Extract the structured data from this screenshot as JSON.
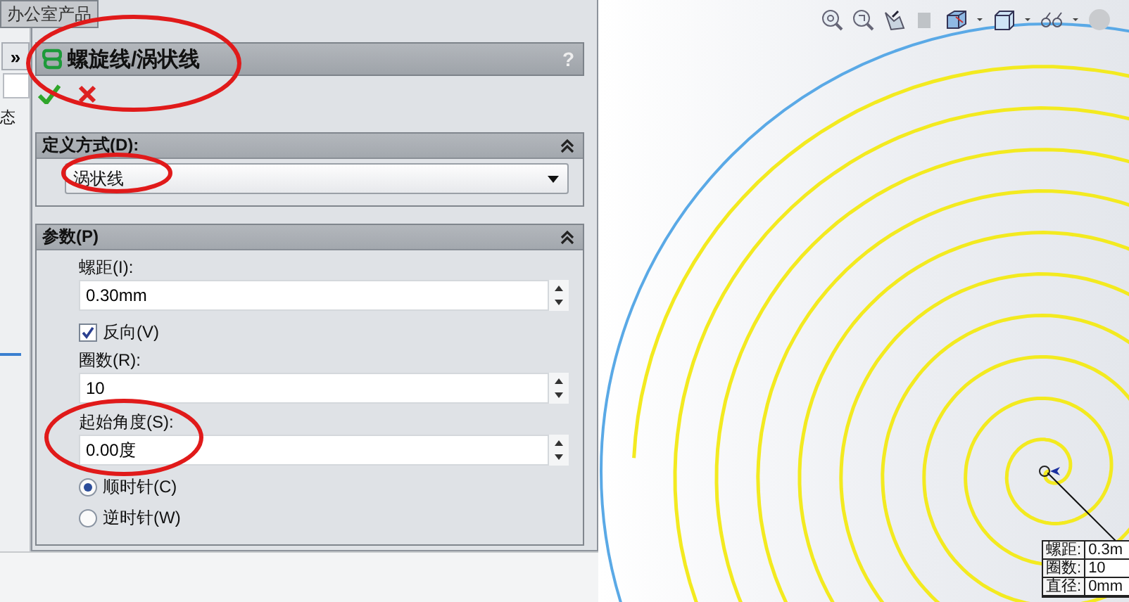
{
  "tab": {
    "label": "办公室产品"
  },
  "side_strip": {
    "expand": "»",
    "label": "态"
  },
  "property_manager": {
    "title": "螺旋线/涡状线",
    "help": "?",
    "definition": {
      "title": "定义方式(D):",
      "expanded": true,
      "value": "涡状线"
    },
    "parameters": {
      "title": "参数(P)",
      "expanded": true,
      "items": [
        {
          "kind": "spin",
          "label": "螺距(I):",
          "value": "0.30mm"
        },
        {
          "kind": "checkbox",
          "label": "反向(V)",
          "checked": true
        },
        {
          "kind": "spin",
          "label": "圈数(R):",
          "value": "10"
        },
        {
          "kind": "spin",
          "label": "起始角度(S):",
          "value": "0.00度"
        },
        {
          "kind": "radio",
          "label": "顺时针(C)",
          "selected": true
        },
        {
          "kind": "radio",
          "label": "逆时针(W)",
          "selected": false
        }
      ]
    }
  },
  "callout": [
    {
      "label": "螺距:",
      "value": "0.3m"
    },
    {
      "label": "圈数:",
      "value": "10"
    },
    {
      "label": "直径:",
      "value": "0mm"
    }
  ]
}
